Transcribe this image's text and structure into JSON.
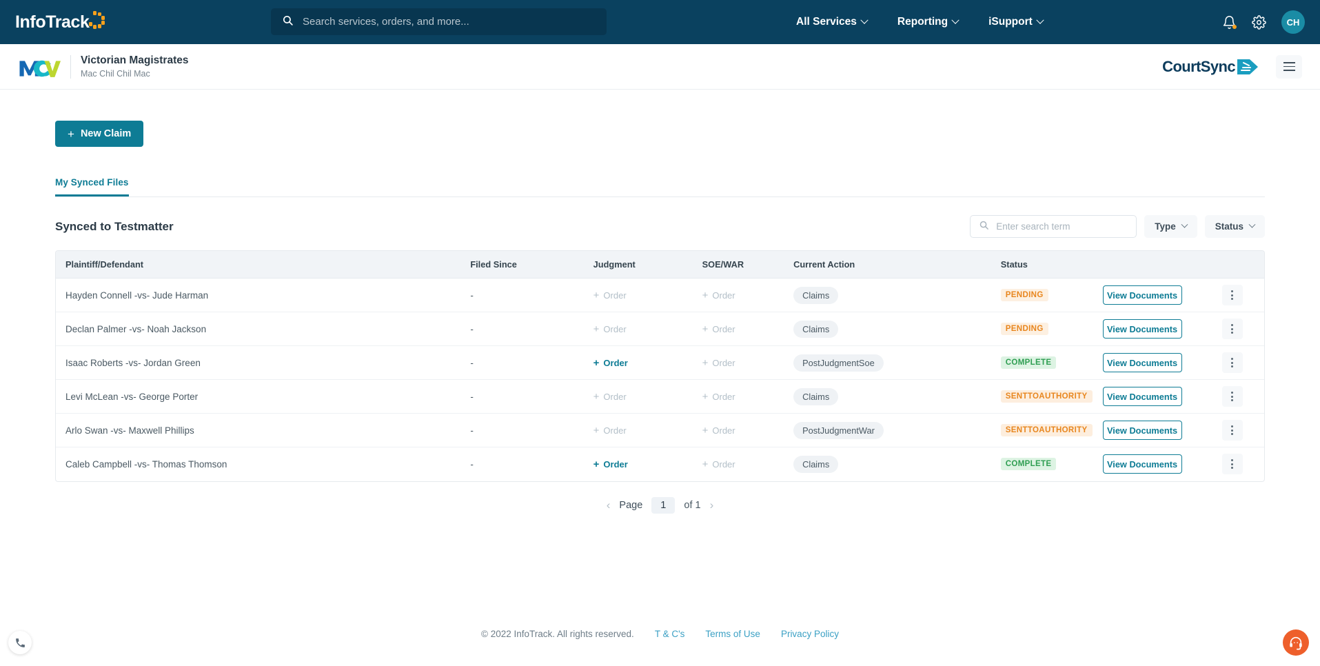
{
  "topnav": {
    "brand": "InfoTrack",
    "search_placeholder": "Search services, orders, and more...",
    "links": [
      {
        "label": "All Services"
      },
      {
        "label": "Reporting"
      },
      {
        "label": "iSupport"
      }
    ],
    "avatar_initials": "CH"
  },
  "subheader": {
    "org_title": "Victorian Magistrates",
    "org_subtitle": "Mac Chil Chil Mac",
    "product_name": "CourtSync"
  },
  "actions": {
    "new_claim": "New Claim",
    "new_claim_plus": "+"
  },
  "tabs": [
    {
      "label": "My Synced Files",
      "active": true
    }
  ],
  "section": {
    "title": "Synced to Testmatter",
    "search_placeholder": "Enter search term",
    "search_value": "",
    "type_filter": "Type",
    "status_filter": "Status"
  },
  "table": {
    "columns": [
      "Plaintiff/Defendant",
      "Filed Since",
      "Judgment",
      "SOE/WAR",
      "Current Action",
      "Status",
      "",
      ""
    ],
    "rows": [
      {
        "party": "Hayden Connell -vs- Jude Harman",
        "filed_since": "-",
        "judgment": "Order",
        "judgment_active": false,
        "soe_war": "Order",
        "soe_war_active": false,
        "current_action": "Claims",
        "status": "PENDING",
        "status_kind": "pending",
        "view_documents": "View Documents"
      },
      {
        "party": "Declan Palmer -vs- Noah Jackson",
        "filed_since": "-",
        "judgment": "Order",
        "judgment_active": false,
        "soe_war": "Order",
        "soe_war_active": false,
        "current_action": "Claims",
        "status": "PENDING",
        "status_kind": "pending",
        "view_documents": "View Documents"
      },
      {
        "party": "Isaac Roberts -vs- Jordan Green",
        "filed_since": "-",
        "judgment": "Order",
        "judgment_active": true,
        "soe_war": "Order",
        "soe_war_active": false,
        "current_action": "PostJudgmentSoe",
        "status": "COMPLETE",
        "status_kind": "complete",
        "view_documents": "View Documents"
      },
      {
        "party": "Levi McLean -vs- George Porter",
        "filed_since": "-",
        "judgment": "Order",
        "judgment_active": false,
        "soe_war": "Order",
        "soe_war_active": false,
        "current_action": "Claims",
        "status": "SENTTOAUTHORITY",
        "status_kind": "sent",
        "view_documents": "View Documents"
      },
      {
        "party": "Arlo Swan -vs- Maxwell Phillips",
        "filed_since": "-",
        "judgment": "Order",
        "judgment_active": false,
        "soe_war": "Order",
        "soe_war_active": false,
        "current_action": "PostJudgmentWar",
        "status": "SENTTOAUTHORITY",
        "status_kind": "sent",
        "view_documents": "View Documents"
      },
      {
        "party": "Caleb Campbell -vs- Thomas Thomson",
        "filed_since": "-",
        "judgment": "Order",
        "judgment_active": true,
        "soe_war": "Order",
        "soe_war_active": false,
        "current_action": "Claims",
        "status": "COMPLETE",
        "status_kind": "complete",
        "view_documents": "View Documents"
      }
    ]
  },
  "pagination": {
    "prev": "‹",
    "page_label": "Page",
    "current_page": "1",
    "of_label": "of 1",
    "next": "›"
  },
  "footer": {
    "copyright": "© 2022 InfoTrack. All rights reserved.",
    "links": [
      {
        "label": "T & C's"
      },
      {
        "label": "Terms of Use"
      },
      {
        "label": "Privacy Policy"
      }
    ]
  },
  "colors": {
    "nav_bg": "#0a415f",
    "accent_teal": "#0e7c95",
    "brand_orange": "#f7a01c",
    "status_pending": "#e8861e",
    "status_complete": "#2f9e52",
    "chat_orange": "#ee5f2b"
  }
}
